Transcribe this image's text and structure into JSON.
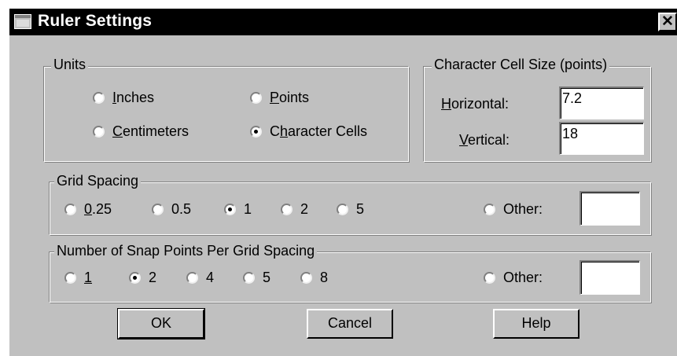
{
  "window": {
    "title": "Ruler Settings",
    "close_glyph": "✕"
  },
  "units": {
    "legend": "Units",
    "options": [
      {
        "label": "Inches",
        "mnemonic": "I",
        "rest": "nches",
        "checked": false
      },
      {
        "label": "Points",
        "mnemonic": "P",
        "rest": "oints",
        "checked": false
      },
      {
        "label": "Centimeters",
        "mnemonic": "C",
        "rest": "entimeters",
        "checked": false
      },
      {
        "label": "Character Cells",
        "pre": "C",
        "mnemonic": "h",
        "rest": "aracter Cells",
        "checked": true
      }
    ]
  },
  "cell_size": {
    "legend": "Character Cell Size (points)",
    "horizontal_label": {
      "mnemonic": "H",
      "rest": "orizontal:"
    },
    "horizontal_value": "7.2",
    "vertical_label": {
      "mnemonic": "V",
      "rest": "ertical:"
    },
    "vertical_value": "18"
  },
  "grid_spacing": {
    "legend": "Grid Spacing",
    "options": [
      {
        "label": "0.25",
        "mnemonic": "0",
        "rest": ".25",
        "checked": false
      },
      {
        "label": "0.5",
        "checked": false
      },
      {
        "label": "1",
        "checked": true
      },
      {
        "label": "2",
        "checked": false
      },
      {
        "label": "5",
        "checked": false
      }
    ],
    "other_label": "Other:",
    "other_value": ""
  },
  "snap_points": {
    "legend": "Number of Snap Points Per Grid Spacing",
    "options": [
      {
        "label": "1",
        "mnemonic": "1",
        "checked": false
      },
      {
        "label": "2",
        "checked": true
      },
      {
        "label": "4",
        "checked": false
      },
      {
        "label": "5",
        "checked": false
      },
      {
        "label": "8",
        "checked": false
      }
    ],
    "other_label": "Other:",
    "other_value": ""
  },
  "buttons": {
    "ok": "OK",
    "cancel": "Cancel",
    "help": "Help"
  }
}
